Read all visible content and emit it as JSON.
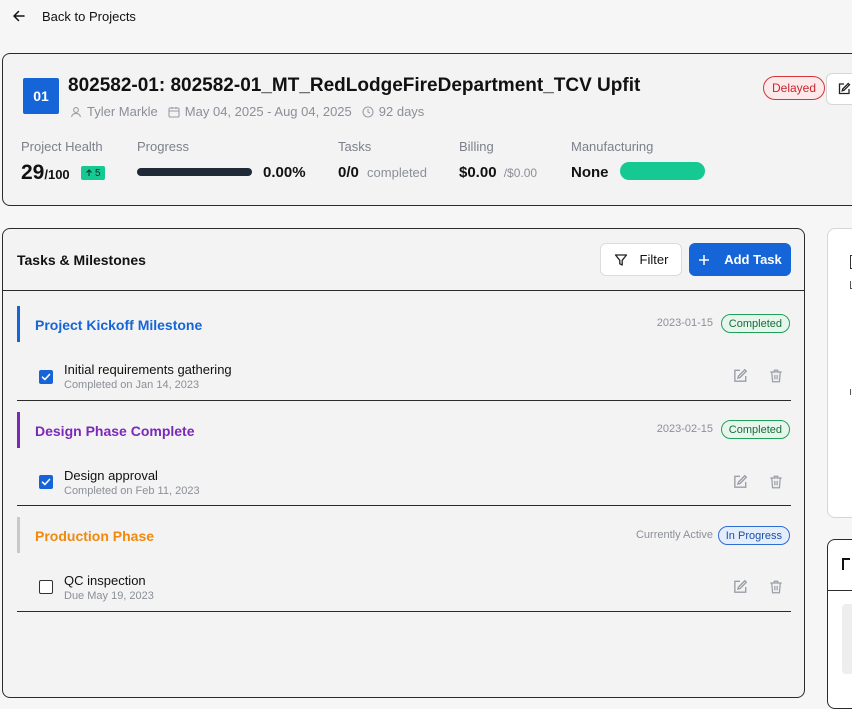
{
  "nav": {
    "back_label": "Back to Projects"
  },
  "project": {
    "badge": "01",
    "title": "802582-01: 802582-01_MT_RedLodgeFireDepartment_TCV Upfit",
    "owner": "Tyler Markle",
    "date_range": "May 04, 2025 - Aug 04, 2025",
    "duration": "92 days",
    "status": "Delayed",
    "stats": {
      "health_label": "Project Health",
      "health_value": "29",
      "health_max": "/100",
      "health_change": "5",
      "progress_label": "Progress",
      "progress_value": "0.00%",
      "progress_fraction": 0.0,
      "tasks_label": "Tasks",
      "tasks_value": "0/0",
      "tasks_suffix": "completed",
      "billing_label": "Billing",
      "billing_value": "$0.00",
      "billing_total": "/$0.00",
      "manufacturing_label": "Manufacturing",
      "manufacturing_value": "None"
    }
  },
  "tasks_panel": {
    "title": "Tasks & Milestones",
    "filter_label": "Filter",
    "add_label": "Add Task",
    "milestones": [
      {
        "title": "Project Kickoff Milestone",
        "color": "#1565d8",
        "date": "2023-01-15",
        "status": "Completed",
        "task": {
          "name": "Initial requirements gathering",
          "detail": "Completed on Jan 14, 2023",
          "done": true
        }
      },
      {
        "title": "Design Phase Complete",
        "color": "#7b28b8",
        "date": "2023-02-15",
        "status": "Completed",
        "task": {
          "name": "Design approval",
          "detail": "Completed on Feb 11, 2023",
          "done": true
        }
      },
      {
        "title": "Production Phase",
        "color": "#f0890c",
        "date": "Currently Active",
        "status": "In Progress",
        "task": {
          "name": "QC inspection",
          "detail": "Due May 19, 2023",
          "done": false
        }
      }
    ]
  },
  "colors": {
    "accent": "#1565d8",
    "success": "#16c993",
    "danger": "#d1363b"
  }
}
